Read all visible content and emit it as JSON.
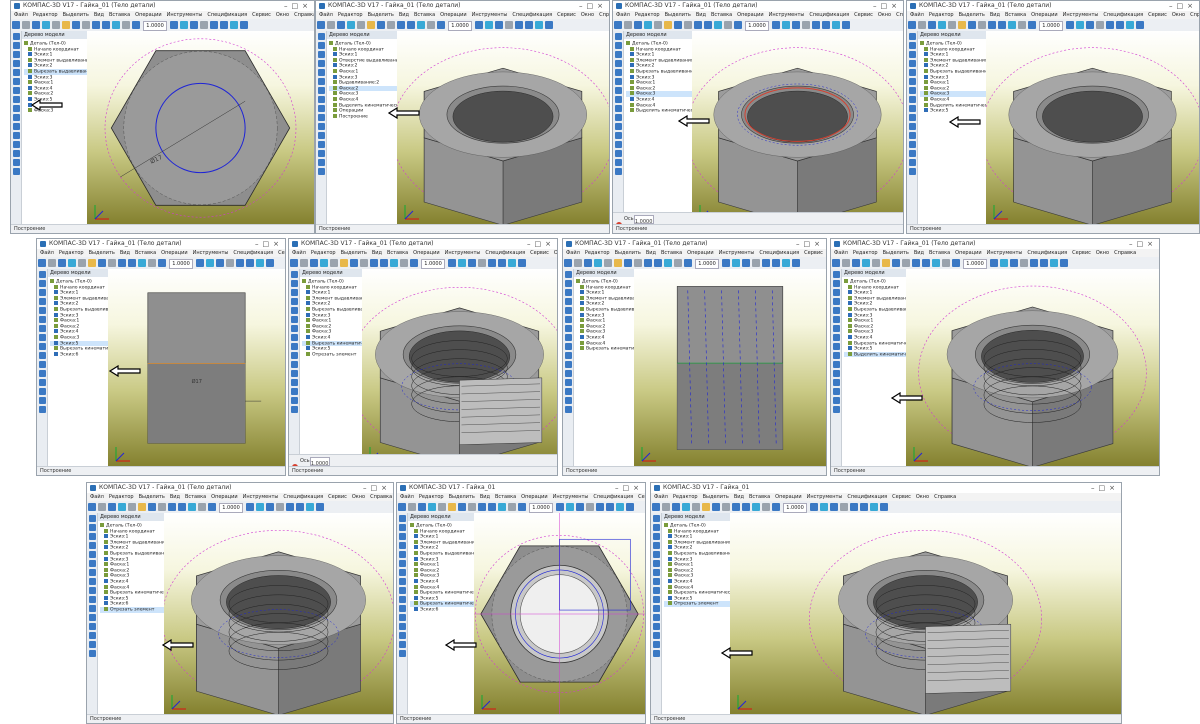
{
  "app": {
    "window_title": "КОМПАС-3D V17",
    "menu": [
      "Файл",
      "Редактор",
      "Выделить",
      "Вид",
      "Вставка",
      "Операции",
      "Инструменты",
      "Спецификация",
      "Сервис",
      "Окно",
      "Справка"
    ]
  },
  "common": {
    "tree_header": "Дерево модели",
    "status_label": "Построение",
    "zoom_value": "1.0000",
    "view_label": "Ось"
  },
  "panels": [
    {
      "id": "p1",
      "title": "Гайка_01 (Тело детали)",
      "view": "front",
      "tree": [
        "Деталь (Тел-0)",
        "Начало координат",
        "Эскиз:1",
        "Элемент выдавливания:1",
        "Эскиз:2",
        "Вырезать выдавливанием:1",
        "Эскиз:3",
        "Фаска:1",
        "Эскиз:4",
        "Фаска:2",
        "Эскиз:5",
        "Эскиз:6",
        "Фаска:3"
      ],
      "highlight": 5,
      "dimension": "Ø17"
    },
    {
      "id": "p2",
      "title": "Гайка_01 (Тело детали)",
      "view": "iso-hole",
      "tree": [
        "Деталь (Тел-0)",
        "Начало координат",
        "Эскиз:1",
        "Отверстие выдавливанием:1",
        "Эскиз:2",
        "Фаска:1",
        "Эскиз:3",
        "Выдавливание:2",
        "Фаска:2",
        "Фаска:3",
        "Фаска:4",
        "Выделить кинематически:1",
        "Операции",
        "Построение"
      ],
      "highlight": 8,
      "dimension": ""
    },
    {
      "id": "p3",
      "title": "Гайка_01 (Тело детали)",
      "view": "iso-hole-preview",
      "tree": [
        "Деталь (Тел-0)",
        "Начало координат",
        "Эскиз:1",
        "Элемент выдавливания:1",
        "Эскиз:2",
        "Вырезать выдавливанием:1",
        "Эскиз:3",
        "Фаска:1",
        "Фаска:2",
        "Фаска:3",
        "Эскиз:4",
        "Фаска:4",
        "Выделить кинематически:1"
      ],
      "highlight": 9,
      "dimension": ""
    },
    {
      "id": "p4",
      "title": "Гайка_01 (Тело детали)",
      "view": "iso-chamfer",
      "tree": [
        "Деталь (Тел-0)",
        "Начало координат",
        "Эскиз:1",
        "Элемент выдавливания:1",
        "Эскиз:2",
        "Вырезать выдавливанием:1",
        "Эскиз:3",
        "Фаска:1",
        "Фаска:2",
        "Фаска:3",
        "Фаска:4",
        "Выделить кинематически:1",
        "Эскиз:5"
      ],
      "highlight": 9,
      "dimension": ""
    },
    {
      "id": "p5",
      "title": "Гайка_01 (Тело детали)",
      "view": "side",
      "tree": [
        "Деталь (Тел-0)",
        "Начало координат",
        "Эскиз:1",
        "Элемент выдавливания:1",
        "Эскиз:2",
        "Вырезать выдавливанием:1",
        "Эскиз:3",
        "Фаска:1",
        "Фаска:2",
        "Эскиз:4",
        "Фаска:3",
        "Эскиз:5",
        "Вырезать кинематически:1",
        "Эскиз:6"
      ],
      "highlight": 11,
      "dimension": "Ø17"
    },
    {
      "id": "p6",
      "title": "Гайка_01 (Тело детали)",
      "view": "iso-thread-cut",
      "tree": [
        "Деталь (Тел-0)",
        "Начало координат",
        "Эскиз:1",
        "Элемент выдавливания:1",
        "Эскиз:2",
        "Вырезать выдавливанием:1",
        "Эскиз:3",
        "Фаска:1",
        "Фаска:2",
        "Фаска:3",
        "Эскиз:4",
        "Вырезать кинематически:1",
        "Эскиз:5",
        "Отрезать элемент"
      ],
      "highlight": 11,
      "dimension": ""
    },
    {
      "id": "p7",
      "title": "Гайка_01 (Тело детали)",
      "view": "side-thread",
      "tree": [
        "Деталь (Тел-0)",
        "Начало координат",
        "Эскиз:1",
        "Элемент выдавливания:1",
        "Эскиз:2",
        "Вырезать выдавливанием:1",
        "Эскиз:3",
        "Фаска:1",
        "Фаска:2",
        "Фаска:3",
        "Эскиз:4",
        "Фаска:4",
        "Вырезать кинематически:1"
      ],
      "highlight": -1,
      "dimension": ""
    },
    {
      "id": "p8",
      "title": "Гайка_01 (Тело детали)",
      "view": "iso-thread",
      "tree": [
        "Деталь (Тел-0)",
        "Начало координат",
        "Эскиз:1",
        "Элемент выдавливания:1",
        "Эскиз:2",
        "Вырезать выдавливанием:1",
        "Эскиз:3",
        "Фаска:1",
        "Фаска:2",
        "Фаска:3",
        "Эскиз:4",
        "Вырезать кинематически:1",
        "Эскиз:5",
        "Выделить кинематически:1"
      ],
      "highlight": 13,
      "dimension": ""
    },
    {
      "id": "p9",
      "title": "Гайка_01 (Тело детали)",
      "view": "iso-thread",
      "tree": [
        "Деталь (Тел-0)",
        "Начало координат",
        "Эскиз:1",
        "Элемент выдавливания:1",
        "Эскиз:2",
        "Вырезать выдавливанием:1",
        "Эскиз:3",
        "Фаска:1",
        "Фаска:2",
        "Фаска:3",
        "Эскиз:4",
        "Фаска:4",
        "Вырезать кинематически:1",
        "Эскиз:5",
        "Эскиз:6",
        "Отрезать элемент"
      ],
      "highlight": 15,
      "dimension": ""
    },
    {
      "id": "p10",
      "title": "Гайка_01",
      "view": "front-thread",
      "tree": [
        "Деталь (Тел-0)",
        "Начало координат",
        "Эскиз:1",
        "Элемент выдавливания:1",
        "Эскиз:2",
        "Вырезать выдавливанием:1",
        "Эскиз:3",
        "Фаска:1",
        "Фаска:2",
        "Фаска:3",
        "Эскиз:4",
        "Фаска:4",
        "Вырезать кинематически:1",
        "Эскиз:5",
        "Вырезать кинематически:2",
        "Эскиз:6"
      ],
      "highlight": 14,
      "dimension": ""
    },
    {
      "id": "p11",
      "title": "Гайка_01",
      "view": "iso-thread-cut",
      "tree": [
        "Деталь (Тел-0)",
        "Начало координат",
        "Эскиз:1",
        "Элемент выдавливания:1",
        "Эскиз:2",
        "Вырезать выдавливанием:1",
        "Эскиз:3",
        "Фаска:1",
        "Фаска:2",
        "Фаска:3",
        "Эскиз:4",
        "Фаска:4",
        "Вырезать кинематически:1",
        "Эскиз:5",
        "Отрезать элемент"
      ],
      "highlight": 14,
      "dimension": ""
    }
  ],
  "colors": {
    "accent": "#2b6fb5",
    "viewport_top": "#ffffff",
    "viewport_bottom": "#83802e",
    "edge": "#2b2b2b",
    "face_light": "#a8a8a8",
    "face_dark": "#5e5e5e",
    "sketch_blue": "#1e24d6",
    "hint_magenta": "#d13ad1"
  }
}
